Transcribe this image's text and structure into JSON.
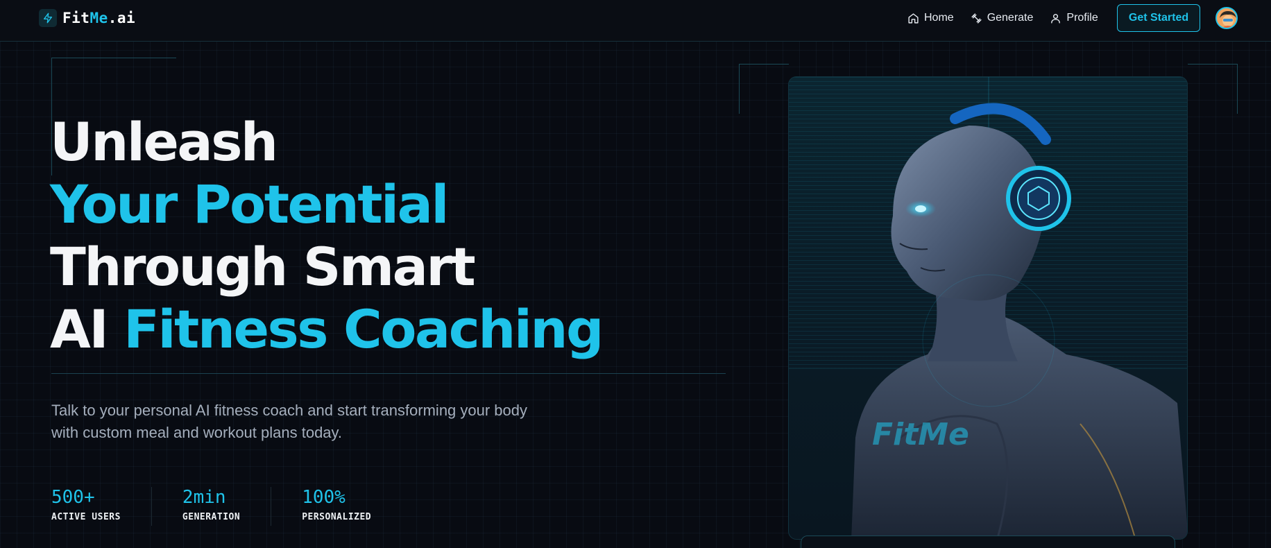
{
  "nav": {
    "logo": {
      "part1": "Fit",
      "part2": "Me",
      "part3": ".ai",
      "icon": "bolt-icon"
    },
    "links": [
      {
        "label": "Home",
        "icon": "home-icon"
      },
      {
        "label": "Generate",
        "icon": "dumbbell-icon"
      },
      {
        "label": "Profile",
        "icon": "user-icon"
      }
    ],
    "cta_label": "Get Started",
    "avatar_icon": "avatar"
  },
  "hero": {
    "line1": "Unleash",
    "line2": "Your Potential",
    "line3": "Through Smart",
    "line4_white": "AI ",
    "line4_cyan": "Fitness Coaching",
    "subtitle": "Talk to your personal AI fitness coach and start transforming your body with custom meal and workout plans today.",
    "stats": [
      {
        "value": "500+",
        "label": "ACTIVE USERS"
      },
      {
        "value": "2min",
        "label": "GENERATION"
      },
      {
        "value": "100%",
        "label": "PERSONALIZED"
      }
    ],
    "image_watermark": "FitMe"
  },
  "colors": {
    "accent": "#1fc3ea",
    "background": "#080b12",
    "text": "#f4f5f7",
    "muted": "#a5afbd"
  }
}
